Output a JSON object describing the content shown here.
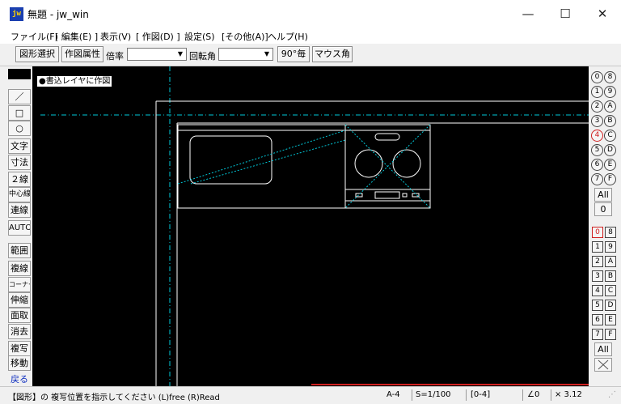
{
  "window": {
    "app_icon_text": "jw",
    "title": "無題 - jw_win",
    "min_symbol": "—",
    "max_symbol": "☐",
    "close_symbol": "✕"
  },
  "menu": [
    "ファイル(F)",
    "[ 編集(E) ]",
    "表示(V)",
    "[ 作図(D) ]",
    "設定(S)",
    "[その他(A)]",
    "ヘルプ(H)"
  ],
  "toolbar": {
    "select_button": "図形選択",
    "attr_button": "作図属性",
    "scale_label": "倍率",
    "scale_value": "",
    "rotation_label": "回転角",
    "rotation_value": "",
    "angle_step_button": "90°毎",
    "mouse_angle_button": "マウス角"
  },
  "left_tools": [
    "／",
    "□",
    "○",
    "文字",
    "寸法",
    "２線",
    "中心線",
    "連線",
    "AUTO",
    "範囲",
    "複線",
    "コーナー",
    "伸縮",
    "面取",
    "消去",
    "複写",
    "移動",
    "戻る"
  ],
  "canvas": {
    "layer_label": "●書込レイヤに作図"
  },
  "layer_groups": {
    "circle_left": [
      "0",
      "1",
      "2",
      "3",
      "4",
      "5",
      "6",
      "7"
    ],
    "circle_right": [
      "8",
      "9",
      "A",
      "B",
      "C",
      "D",
      "E",
      "F"
    ],
    "active_group": "4",
    "all_label": "All",
    "zero_label": "0"
  },
  "layers": {
    "left": [
      "0",
      "1",
      "2",
      "3",
      "4",
      "5",
      "6",
      "7"
    ],
    "right": [
      "8",
      "9",
      "A",
      "B",
      "C",
      "D",
      "E",
      "F"
    ],
    "active_layer": "0",
    "all_label": "All"
  },
  "status": {
    "message": "【図形】の 複写位置を指示してください (L)free (R)Read",
    "paper": "A-4",
    "scale": "S=1/100",
    "layer_info": "[0-4]",
    "angle": "∠0",
    "zoom": "× 3.12"
  },
  "colors": {
    "canvas_bg": "#000000",
    "line_white": "#ffffff",
    "line_cyan": "#00c8d8",
    "active_red": "#d02020"
  }
}
